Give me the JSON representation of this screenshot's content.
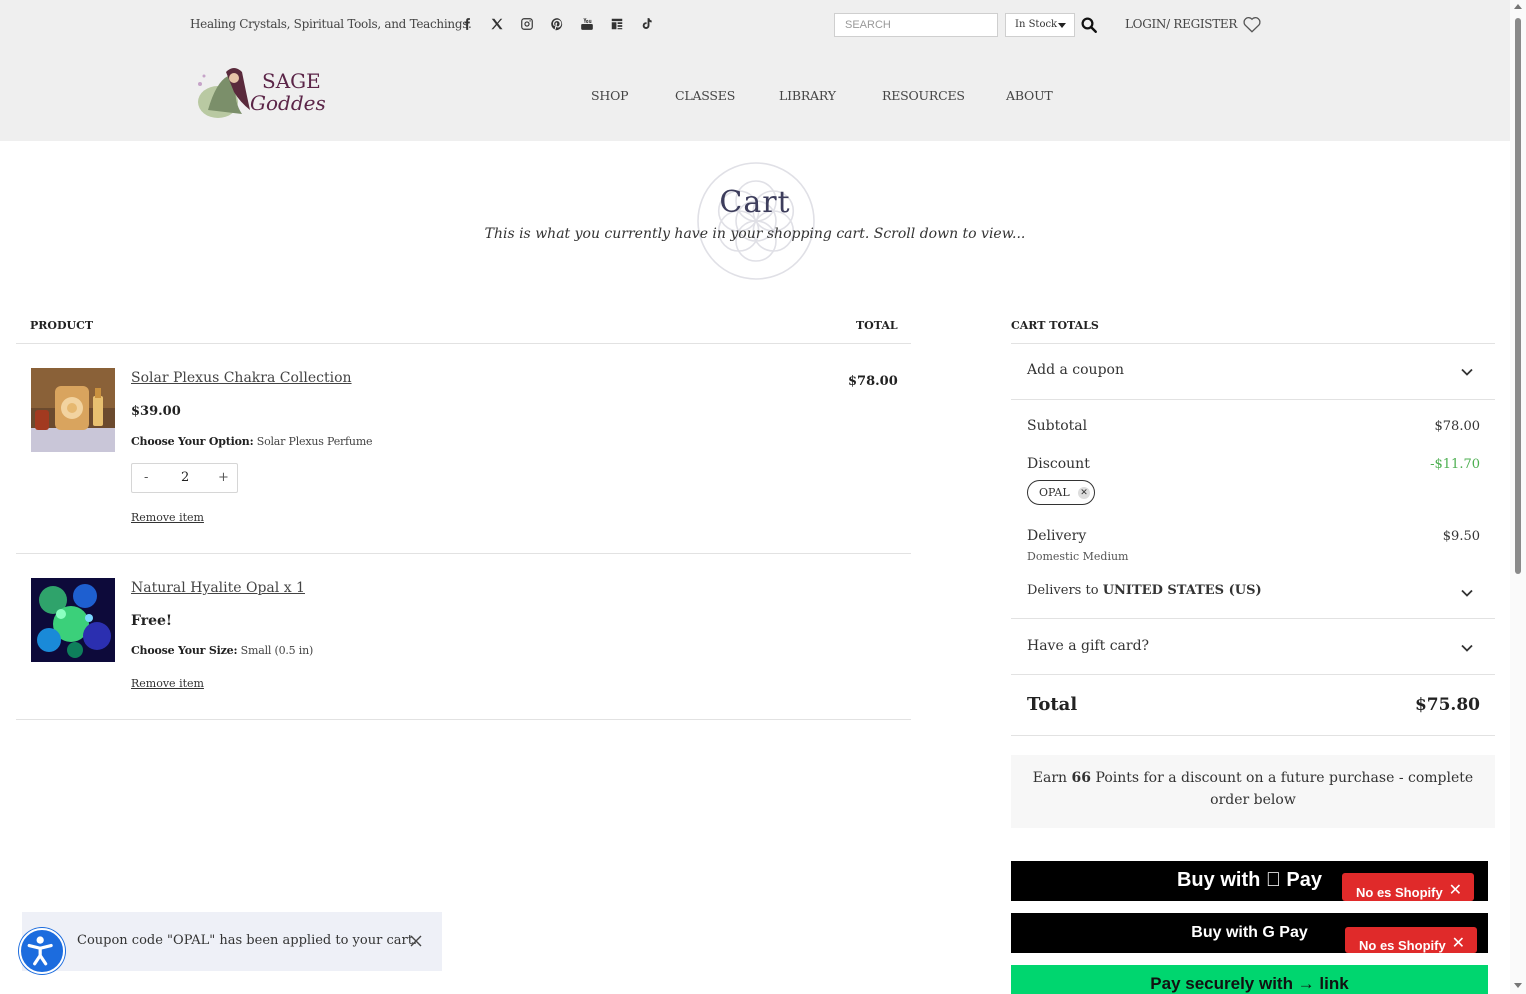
{
  "header": {
    "tagline": "Healing Crystals, Spiritual Tools, and Teachings.",
    "socials": [
      "facebook-icon",
      "x-icon",
      "instagram-icon",
      "pinterest-icon",
      "youtube-icon",
      "blog-icon",
      "tiktok-icon"
    ],
    "search_placeholder": "SEARCH",
    "stock_filter": "In Stock",
    "login_label": "LOGIN/ REGISTER",
    "logo_text": "Sage Goddess",
    "nav": [
      "SHOP",
      "CLASSES",
      "LIBRARY",
      "RESOURCES",
      "ABOUT"
    ]
  },
  "page": {
    "title": "Cart",
    "subtitle": "This is what you currently have in your shopping cart. Scroll down to view..."
  },
  "cart_table": {
    "col_product": "PRODUCT",
    "col_total": "TOTAL",
    "items": [
      {
        "name": "Solar Plexus Chakra Collection",
        "price": "$39.00",
        "option_label": "Choose Your Option:",
        "option_value": "Solar Plexus Perfume",
        "qty_minus": "-",
        "quantity": "2",
        "qty_plus": "+",
        "remove_label": "Remove item",
        "line_total": "$78.00"
      },
      {
        "name": "Natural Hyalite Opal x 1",
        "price": "Free!",
        "option_label": "Choose Your Size:",
        "option_value": "Small (0.5 in)",
        "remove_label": "Remove item"
      }
    ]
  },
  "totals": {
    "title": "CART TOTALS",
    "coupon_label": "Add a coupon",
    "subtotal_label": "Subtotal",
    "subtotal_value": "$78.00",
    "discount_label": "Discount",
    "discount_value": "-$11.70",
    "coupon_code": "OPAL",
    "delivery_label": "Delivery",
    "delivery_value": "$9.50",
    "delivery_method": "Domestic Medium",
    "delivers_to_prefix": "Delivers to",
    "delivers_to_country": "UNITED STATES (US)",
    "gift_card_label": "Have a gift card?",
    "total_label": "Total",
    "total_value": "$75.80",
    "points_prefix": "Earn",
    "points_value": "66",
    "points_suffix": "Points for a discount on a future purchase - complete order below",
    "discount_color": "#4caf50"
  },
  "payment": {
    "apple_pay": "Buy with  Pay",
    "google_pay": "Buy with G Pay",
    "link_pay": "Pay securely with → link",
    "not_shopify": "No es Shopify",
    "link_color": "#00d66f",
    "badge_color": "#e02a2a"
  },
  "toast": {
    "message": "Coupon code \"OPAL\" has been applied to your cart."
  }
}
